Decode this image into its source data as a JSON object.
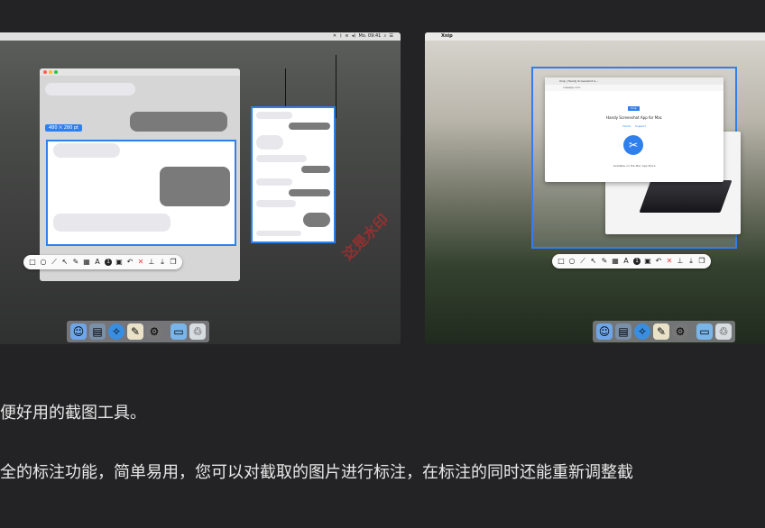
{
  "left_screenshot": {
    "menubar": {
      "status_text": "Mo. 09:41",
      "icons": [
        "xnip-icon",
        "bluetooth-icon",
        "wifi-icon",
        "volume-icon",
        "search-icon",
        "menu-list-icon"
      ]
    },
    "selection_size_badge": "480 ⨉ 280 pt",
    "annotation_toolbar": {
      "tools": [
        "rectangle-icon",
        "circle-icon",
        "line-icon",
        "arrow-icon",
        "pencil-icon",
        "mosaic-icon",
        "text-icon",
        "number-icon",
        "highlight-icon",
        "undo-icon",
        "close-icon",
        "pin-icon",
        "download-icon",
        "copy-icon"
      ],
      "text_tool_label": "A",
      "number_tool_label": "1"
    },
    "dock": [
      "finder-icon",
      "preview-icon",
      "safari-icon",
      "pages-icon",
      "settings-icon",
      "folder-icon",
      "trash-icon"
    ]
  },
  "right_screenshot": {
    "menubar": {
      "app_name": "Xnip"
    },
    "browser": {
      "tab_title": "Xnip | Handy Screenshot A…",
      "url": "xnipapp.com",
      "logo_label": "Xnip",
      "heading": "Handy Screenshot App for Mac",
      "links": [
        "Home",
        "Support"
      ],
      "footer": "Available on the Mac App Store"
    },
    "annotation_toolbar": {
      "tools": [
        "rectangle-icon",
        "circle-icon",
        "line-icon",
        "arrow-icon",
        "pencil-icon",
        "mosaic-icon",
        "text-icon",
        "number-icon",
        "highlight-icon",
        "undo-icon",
        "close-icon",
        "pin-icon",
        "download-icon",
        "copy-icon"
      ],
      "text_tool_label": "A",
      "number_tool_label": "1"
    },
    "dock": [
      "finder-icon",
      "preview-icon",
      "safari-icon",
      "pages-icon",
      "settings-icon",
      "folder-icon",
      "trash-icon"
    ]
  },
  "watermark": "这是水印",
  "captions": {
    "line1": "便好用的截图工具。",
    "line2": "全的标注功能，简单易用，您可以对截取的图片进行标注，在标注的同时还能重新调整截"
  }
}
